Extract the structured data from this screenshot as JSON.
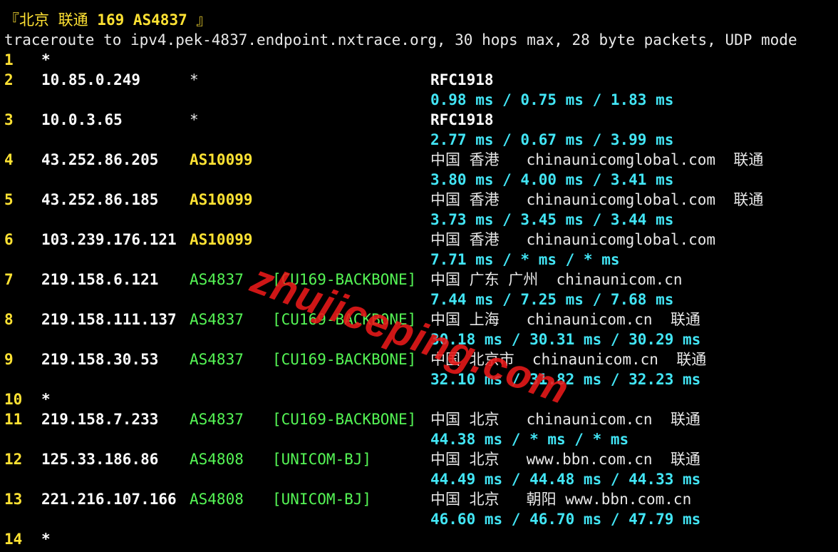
{
  "header": {
    "title_prefix": "『北京 联通 ",
    "title_bold": "169 AS4837",
    "title_suffix": " 』",
    "command": "traceroute to ipv4.pek-4837.endpoint.nxtrace.org, 30 hops max, 28 byte packets, UDP mode"
  },
  "hops": [
    {
      "hop": "1",
      "ip": "*"
    },
    {
      "hop": "2",
      "ip": "10.85.0.249",
      "asn": "*",
      "geo": "RFC1918",
      "rtt": "0.98 ms / 0.75 ms / 1.83 ms"
    },
    {
      "hop": "3",
      "ip": "10.0.3.65",
      "asn": "*",
      "geo": "RFC1918",
      "rtt": "2.77 ms / 0.67 ms / 3.99 ms"
    },
    {
      "hop": "4",
      "ip": "43.252.86.205",
      "asn": "AS10099",
      "geo": "中国 香港   chinaunicomglobal.com  联通",
      "rtt": "3.80 ms / 4.00 ms / 3.41 ms"
    },
    {
      "hop": "5",
      "ip": "43.252.86.185",
      "asn": "AS10099",
      "geo": "中国 香港   chinaunicomglobal.com  联通",
      "rtt": "3.73 ms / 3.45 ms / 3.44 ms"
    },
    {
      "hop": "6",
      "ip": "103.239.176.121",
      "asn": "AS10099",
      "geo": "中国 香港   chinaunicomglobal.com",
      "rtt": "7.71 ms / * ms / * ms"
    },
    {
      "hop": "7",
      "ip": "219.158.6.121",
      "asn": "AS4837",
      "tag": "[CU169-BACKBONE]",
      "geo": "中国 广东 广州  chinaunicom.cn",
      "rtt": "7.44 ms / 7.25 ms / 7.68 ms"
    },
    {
      "hop": "8",
      "ip": "219.158.111.137",
      "asn": "AS4837",
      "tag": "[CU169-BACKBONE]",
      "geo": "中国 上海   chinaunicom.cn  联通",
      "rtt": "30.18 ms / 30.31 ms / 30.29 ms"
    },
    {
      "hop": "9",
      "ip": "219.158.30.53",
      "asn": "AS4837",
      "tag": "[CU169-BACKBONE]",
      "geo": "中国 北京市  chinaunicom.cn  联通",
      "rtt": "32.10 ms / 31.82 ms / 32.23 ms"
    },
    {
      "hop": "10",
      "ip": "*"
    },
    {
      "hop": "11",
      "ip": "219.158.7.233",
      "asn": "AS4837",
      "tag": "[CU169-BACKBONE]",
      "geo": "中国 北京   chinaunicom.cn  联通",
      "rtt": "44.38 ms / * ms / * ms"
    },
    {
      "hop": "12",
      "ip": "125.33.186.86",
      "asn": "AS4808",
      "tag": "[UNICOM-BJ]",
      "geo": "中国 北京   www.bbn.com.cn  联通",
      "rtt": "44.49 ms / 44.48 ms / 44.33 ms"
    },
    {
      "hop": "13",
      "ip": "221.216.107.166",
      "asn": "AS4808",
      "tag": "[UNICOM-BJ]",
      "geo": "中国 北京   朝阳 www.bbn.com.cn",
      "rtt": "46.60 ms / 46.70 ms / 47.79 ms"
    },
    {
      "hop": "14",
      "ip": "*"
    }
  ],
  "watermark": "zhujiceping.com",
  "colors": {
    "background": "#000000",
    "hop_number": "#ffe233",
    "ip": "#ffffff",
    "asn_as10099": "#ffe233",
    "asn_as4837_as4808": "#55f555",
    "backbone_tag": "#55f555",
    "rtt": "#42e5f5",
    "watermark": "#eb1919"
  }
}
